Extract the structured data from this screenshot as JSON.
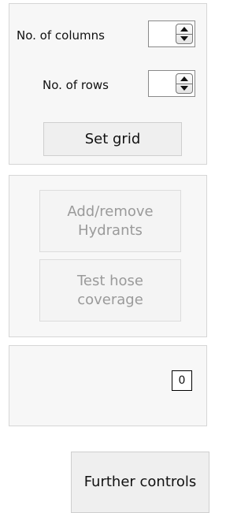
{
  "grid_settings": {
    "columns_label": "No. of columns",
    "columns_value": "",
    "rows_label": "No. of rows",
    "rows_value": "",
    "set_grid_label": "Set grid"
  },
  "tools": {
    "add_remove_hydrants_label": "Add/remove Hydrants",
    "add_remove_hydrants_enabled": false,
    "test_hose_coverage_label": "Test hose coverage",
    "test_hose_coverage_enabled": false
  },
  "counter": {
    "value": "0"
  },
  "further_controls_label": "Further controls",
  "icons": {
    "spinner_up": "arrow-up-icon",
    "spinner_down": "arrow-down-icon"
  },
  "colors": {
    "panel_background": "#f7f7f7",
    "button_background": "#efefef",
    "disabled_text": "#9a9a9a"
  }
}
